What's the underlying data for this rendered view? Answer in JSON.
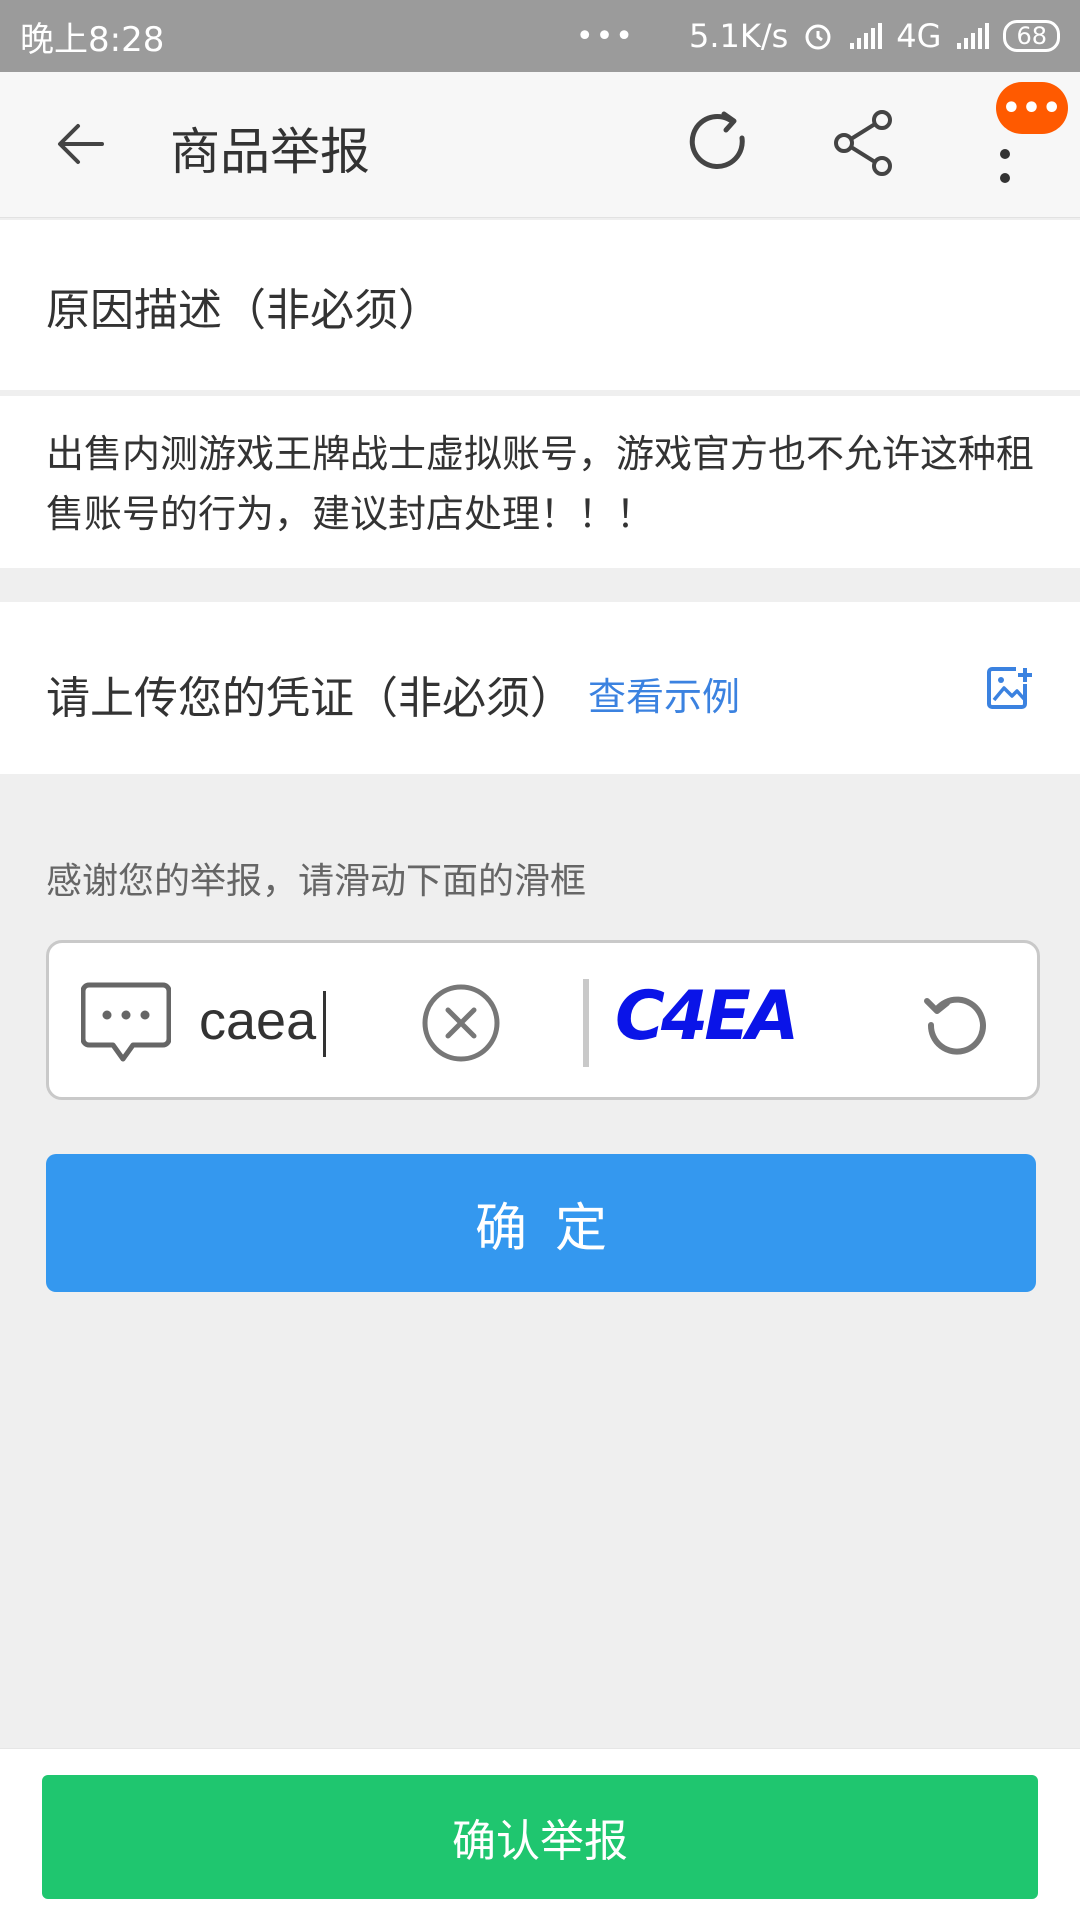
{
  "status_bar": {
    "time": "晚上8:28",
    "dots": "•••",
    "network_speed": "5.1K/s",
    "network_type": "4G",
    "battery": "68"
  },
  "toolbar": {
    "title": "商品举报",
    "badge": "•••"
  },
  "reason": {
    "title": "原因描述（非必须）",
    "text": "出售内测游戏王牌战士虚拟账号，游戏官方也不允许这种租售账号的行为，建议封店处理！！！"
  },
  "upload": {
    "label": "请上传您的凭证（非必须）",
    "example_link": "查看示例"
  },
  "hint": "感谢您的举报，请滑动下面的滑框",
  "captcha": {
    "input_value": "caea",
    "image_text": "C4EA"
  },
  "confirm_button": "确定",
  "report_button": "确认举报",
  "colors": {
    "primary_blue": "#3498ef",
    "report_green": "#1fc66f",
    "link_blue": "#3b82e0",
    "badge_orange": "#ff5a00",
    "captcha_text": "#0a14e8"
  },
  "icons": [
    "back-arrow-icon",
    "refresh-icon",
    "share-icon",
    "more-vertical-icon",
    "add-image-icon",
    "chat-bubble-icon",
    "clear-icon",
    "captcha-refresh-icon",
    "alarm-icon",
    "signal-icon"
  ]
}
